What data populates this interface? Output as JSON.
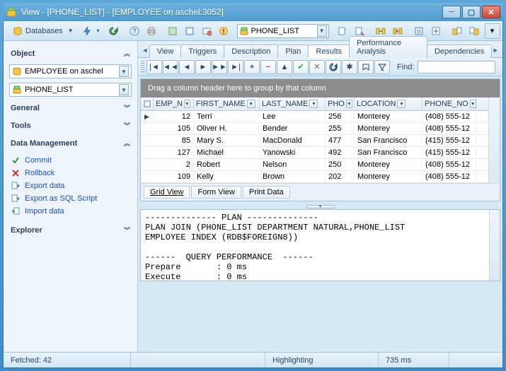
{
  "window": {
    "title": "View - [PHONE_LIST] - [EMPLOYEE on aschel:3052]"
  },
  "toolbar": {
    "databases_label": "Databases",
    "object_dd": "PHONE_LIST"
  },
  "sidebar": {
    "object_header": "Object",
    "db_dd": "EMPLOYEE on aschel",
    "obj_dd": "PHONE_LIST",
    "general_header": "General",
    "tools_header": "Tools",
    "dm_header": "Data Management",
    "links": {
      "commit": "Commit",
      "rollback": "Rollback",
      "export_data": "Export data",
      "export_sql": "Export as SQL Script",
      "import_data": "Import data"
    },
    "explorer_header": "Explorer"
  },
  "tabs": {
    "view": "View",
    "triggers": "Triggers",
    "description": "Description",
    "plan": "Plan",
    "results": "Results",
    "perf": "Performance Analysis",
    "deps": "Dependencies"
  },
  "gridtoolbar": {
    "find_label": "Find:",
    "find_value": ""
  },
  "grid": {
    "groupbar": "Drag a column header here to group by that column",
    "columns": {
      "emp": "EMP_N",
      "first": "FIRST_NAME",
      "last": "LAST_NAME",
      "pho": "PHO",
      "loc": "LOCATION",
      "phone": "PHONE_NO"
    },
    "rows": [
      {
        "emp": "12",
        "first": "Terri",
        "last": "Lee",
        "pho": "256",
        "loc": "Monterey",
        "phone": "(408) 555-12"
      },
      {
        "emp": "105",
        "first": "Oliver H.",
        "last": "Bender",
        "pho": "255",
        "loc": "Monterey",
        "phone": "(408) 555-12"
      },
      {
        "emp": "85",
        "first": "Mary S.",
        "last": "MacDonald",
        "pho": "477",
        "loc": "San Francisco",
        "phone": "(415) 555-12"
      },
      {
        "emp": "127",
        "first": "Michael",
        "last": "Yanowski",
        "pho": "492",
        "loc": "San Francisco",
        "phone": "(415) 555-12"
      },
      {
        "emp": "2",
        "first": "Robert",
        "last": "Nelson",
        "pho": "250",
        "loc": "Monterey",
        "phone": "(408) 555-12"
      },
      {
        "emp": "109",
        "first": "Kelly",
        "last": "Brown",
        "pho": "202",
        "loc": "Monterey",
        "phone": "(408) 555-12"
      }
    ],
    "footer": {
      "grid_view": "Grid View",
      "form_view": "Form View",
      "print_data": "Print Data"
    }
  },
  "plan_text": "-------------- PLAN --------------\nPLAN JOIN (PHONE_LIST DEPARTMENT NATURAL,PHONE_LIST\nEMPLOYEE INDEX (RDB$FOREIGN8))\n\n------  QUERY PERFORMANCE  ------\nPrepare       : 0 ms\nExecute       : 0 ms",
  "status": {
    "fetched": "Fetched: 42",
    "highlight": "Highlighting",
    "time": "735 ms"
  }
}
